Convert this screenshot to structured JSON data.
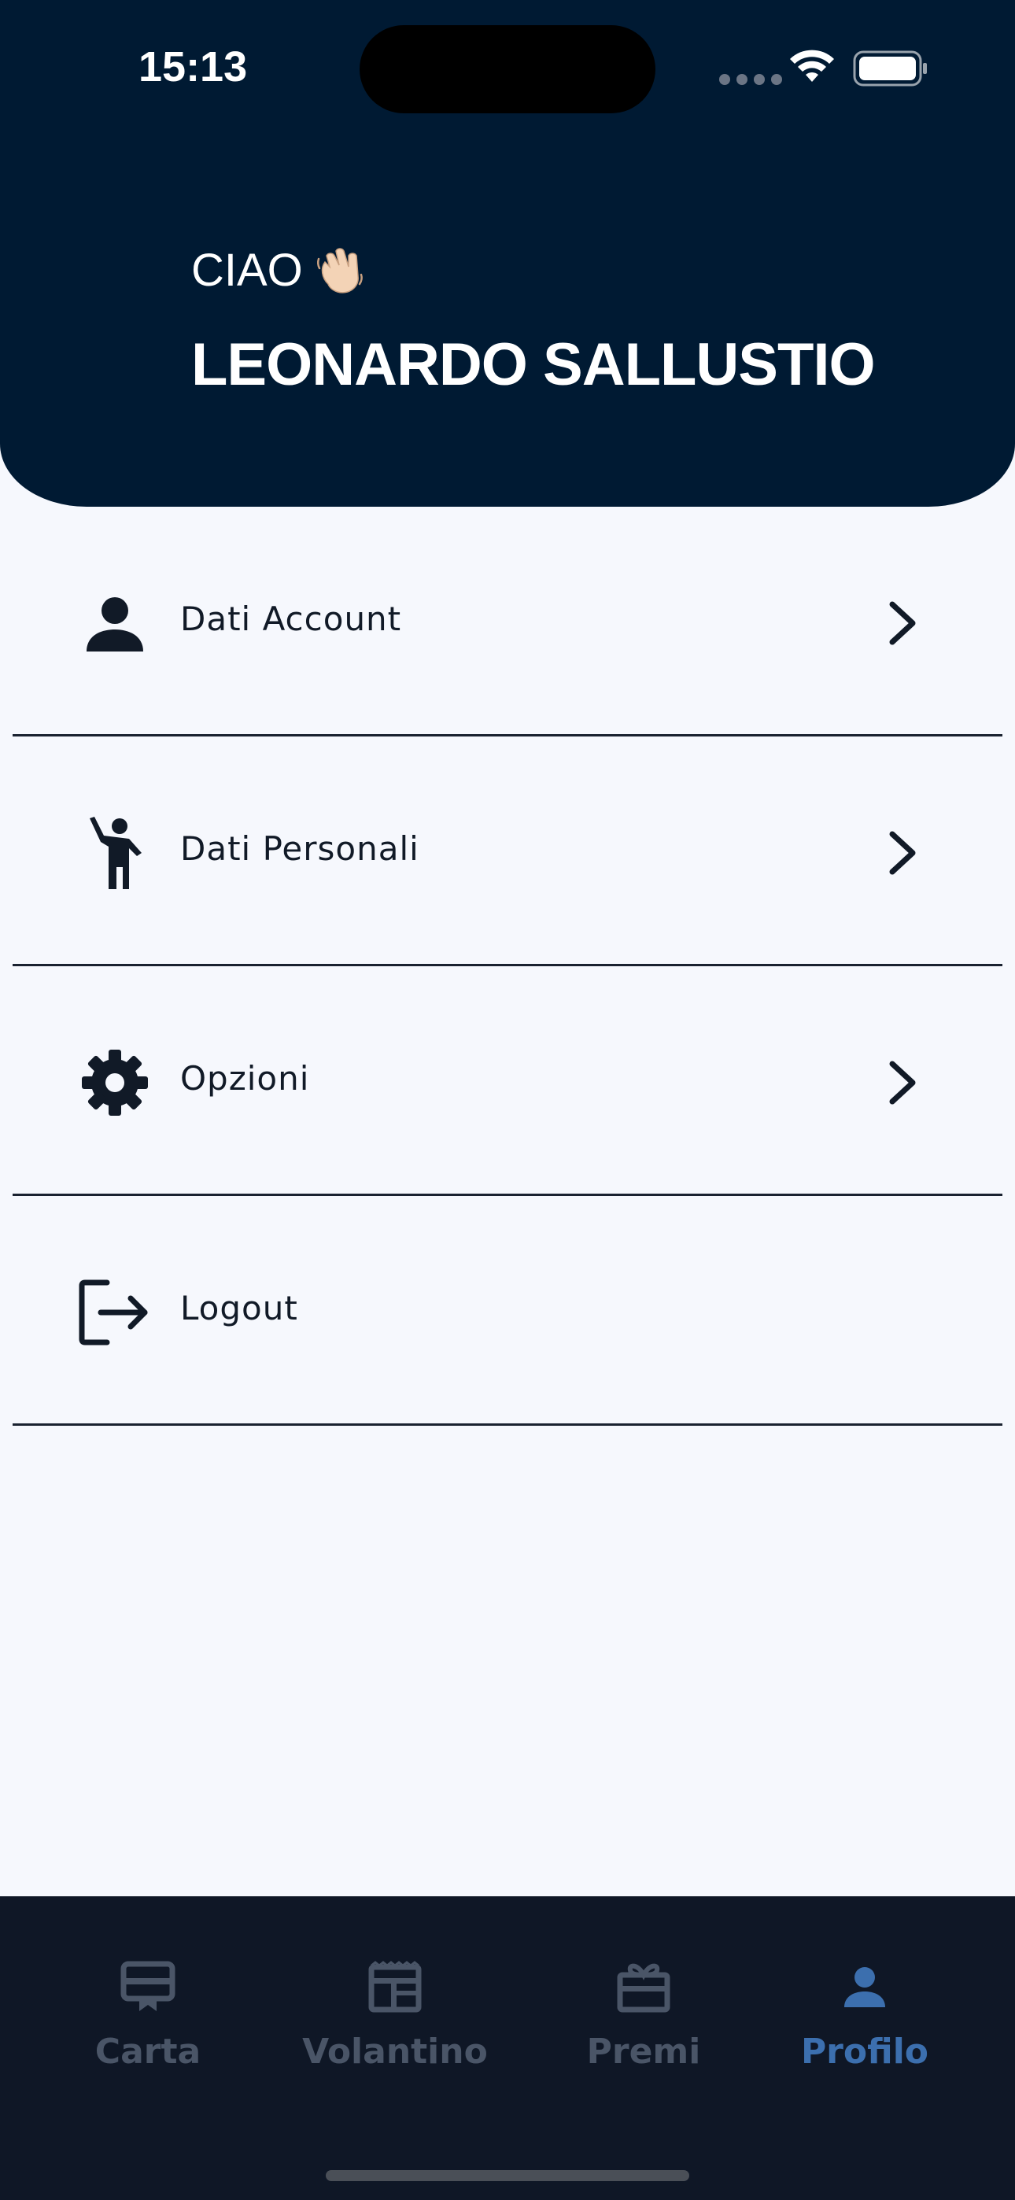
{
  "status_bar": {
    "time": "15:13",
    "icons": [
      "signal-dots-icon",
      "wifi-icon",
      "battery-icon"
    ]
  },
  "header": {
    "greeting": "CIAO",
    "greeting_icon": "waving-hand-icon",
    "user_name": "LEONARDO SALLUSTIO",
    "background_color": "#001a33"
  },
  "menu": {
    "items": [
      {
        "label": "Dati Account",
        "icon": "person-icon",
        "has_chevron": true
      },
      {
        "label": "Dati Personali",
        "icon": "person-waving-icon",
        "has_chevron": true
      },
      {
        "label": "Opzioni",
        "icon": "gear-icon",
        "has_chevron": true
      },
      {
        "label": "Logout",
        "icon": "logout-icon",
        "has_chevron": false
      }
    ]
  },
  "bottom_nav": {
    "items": [
      {
        "label": "Carta",
        "icon": "card-icon",
        "active": false
      },
      {
        "label": "Volantino",
        "icon": "flyer-icon",
        "active": false
      },
      {
        "label": "Premi",
        "icon": "gift-icon",
        "active": false
      },
      {
        "label": "Profilo",
        "icon": "profile-icon",
        "active": true
      }
    ],
    "active_color": "#3c6fae",
    "inactive_color": "#4a5567"
  }
}
